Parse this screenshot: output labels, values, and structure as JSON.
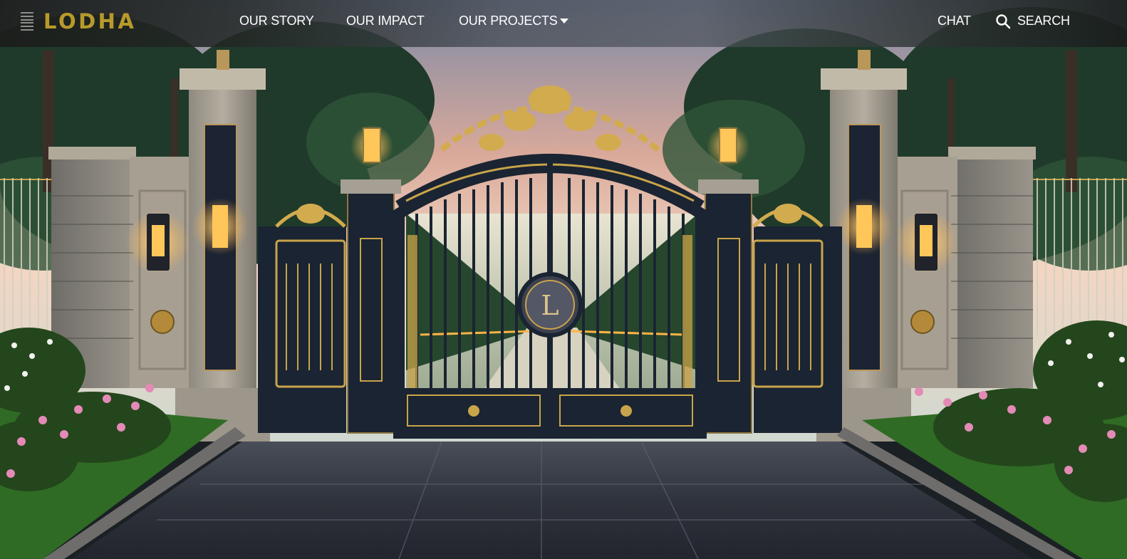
{
  "nav": {
    "logo_text": "LODHA",
    "items": [
      {
        "label": "OUR STORY"
      },
      {
        "label": "OUR IMPACT"
      },
      {
        "label": "OUR PROJECTS"
      }
    ],
    "chat_label": "CHAT",
    "search_label": "SEARCH"
  },
  "hero": {
    "gate_monogram": "L"
  },
  "colors": {
    "brand_gold": "#b89a2c",
    "nav_text": "#ffffff",
    "gate_dark": "#1a2432",
    "gold_ornament": "#c9a44a"
  },
  "icons": [
    "menu-icon",
    "chevron-down-icon",
    "search-icon"
  ]
}
